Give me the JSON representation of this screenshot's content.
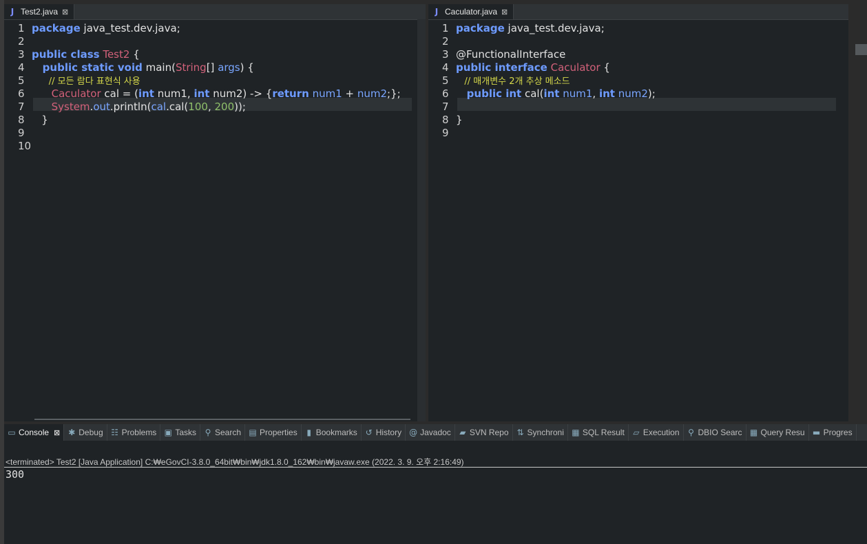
{
  "left_editor": {
    "tab": {
      "icon": "java-file-icon",
      "icon_glyph": "J",
      "label": "Test2.java",
      "close": "⊠"
    },
    "lines": [
      {
        "n": "1",
        "tokens": [
          {
            "t": "package",
            "c": "kw"
          },
          {
            "t": " java_test.dev.java;",
            "c": "plain"
          }
        ]
      },
      {
        "n": "2",
        "tokens": []
      },
      {
        "n": "3",
        "tokens": [
          {
            "t": "public class",
            "c": "kw"
          },
          {
            "t": " ",
            "c": "plain"
          },
          {
            "t": "Test2",
            "c": "cls"
          },
          {
            "t": " {",
            "c": "plain"
          }
        ]
      },
      {
        "n": "4",
        "tokens": [
          {
            "t": "   public static void",
            "c": "kw"
          },
          {
            "t": " main(",
            "c": "plain"
          },
          {
            "t": "String",
            "c": "cls"
          },
          {
            "t": "[] ",
            "c": "plain"
          },
          {
            "t": "args",
            "c": "par"
          },
          {
            "t": ") {",
            "c": "plain"
          }
        ]
      },
      {
        "n": "5",
        "tokens": [
          {
            "t": "      // 모든 람다 표현식 사용",
            "c": "cm"
          }
        ]
      },
      {
        "n": "6",
        "tokens": [
          {
            "t": "      Caculator",
            "c": "cls"
          },
          {
            "t": " cal = (",
            "c": "plain"
          },
          {
            "t": "int",
            "c": "kw"
          },
          {
            "t": " num1, ",
            "c": "plain"
          },
          {
            "t": "int",
            "c": "kw"
          },
          {
            "t": " num2) -> {",
            "c": "plain"
          },
          {
            "t": "return",
            "c": "kw"
          },
          {
            "t": " ",
            "c": "plain"
          },
          {
            "t": "num1",
            "c": "par"
          },
          {
            "t": " + ",
            "c": "plain"
          },
          {
            "t": "num2",
            "c": "par"
          },
          {
            "t": ";};",
            "c": "plain"
          }
        ]
      },
      {
        "n": "7",
        "tokens": [
          {
            "t": "      System",
            "c": "cls"
          },
          {
            "t": ".",
            "c": "plain"
          },
          {
            "t": "out",
            "c": "fld"
          },
          {
            "t": ".println(",
            "c": "plain"
          },
          {
            "t": "cal",
            "c": "par"
          },
          {
            "t": ".cal(",
            "c": "plain"
          },
          {
            "t": "100",
            "c": "num"
          },
          {
            "t": ", ",
            "c": "plain"
          },
          {
            "t": "200",
            "c": "num"
          },
          {
            "t": "));",
            "c": "plain"
          }
        ]
      },
      {
        "n": "8",
        "tokens": [
          {
            "t": "   }",
            "c": "plain"
          }
        ]
      },
      {
        "n": "9",
        "tokens": [
          {
            "t": "",
            "c": "plain"
          }
        ]
      },
      {
        "n": "10",
        "tokens": []
      }
    ]
  },
  "right_editor": {
    "tab": {
      "icon": "java-file-icon",
      "icon_glyph": "J",
      "label": "Caculator.java",
      "close": "⊠"
    },
    "lines": [
      {
        "n": "1",
        "tokens": [
          {
            "t": "package",
            "c": "kw"
          },
          {
            "t": " java_test.dev.java;",
            "c": "plain"
          }
        ]
      },
      {
        "n": "2",
        "tokens": []
      },
      {
        "n": "3",
        "tokens": [
          {
            "t": "@FunctionalInterface",
            "c": "plain"
          }
        ]
      },
      {
        "n": "4",
        "tokens": [
          {
            "t": "public interface",
            "c": "kw"
          },
          {
            "t": " ",
            "c": "plain"
          },
          {
            "t": "Caculator",
            "c": "cls"
          },
          {
            "t": " {",
            "c": "plain"
          }
        ]
      },
      {
        "n": "5",
        "tokens": [
          {
            "t": "   // 매개변수 2개 추상 메소드",
            "c": "cm"
          }
        ]
      },
      {
        "n": "6",
        "tokens": [
          {
            "t": "   public int",
            "c": "kw"
          },
          {
            "t": " cal(",
            "c": "plain"
          },
          {
            "t": "int",
            "c": "kw"
          },
          {
            "t": " ",
            "c": "plain"
          },
          {
            "t": "num1",
            "c": "par"
          },
          {
            "t": ", ",
            "c": "plain"
          },
          {
            "t": "int",
            "c": "kw"
          },
          {
            "t": " ",
            "c": "plain"
          },
          {
            "t": "num2",
            "c": "par"
          },
          {
            "t": ");",
            "c": "plain"
          }
        ]
      },
      {
        "n": "7",
        "tokens": []
      },
      {
        "n": "8",
        "tokens": [
          {
            "t": "}",
            "c": "plain"
          }
        ]
      },
      {
        "n": "9",
        "tokens": []
      }
    ]
  },
  "console": {
    "tabs": [
      {
        "icon": "console-icon",
        "glyph": "▭",
        "label": "Console",
        "close": "⊠",
        "active": true
      },
      {
        "icon": "debug-icon",
        "glyph": "✱",
        "label": "Debug"
      },
      {
        "icon": "problems-icon",
        "glyph": "☷",
        "label": "Problems"
      },
      {
        "icon": "tasks-icon",
        "glyph": "▣",
        "label": "Tasks"
      },
      {
        "icon": "search-icon",
        "glyph": "⚲",
        "label": "Search"
      },
      {
        "icon": "properties-icon",
        "glyph": "▤",
        "label": "Properties"
      },
      {
        "icon": "bookmark-icon",
        "glyph": "▮",
        "label": "Bookmarks"
      },
      {
        "icon": "history-icon",
        "glyph": "↺",
        "label": "History"
      },
      {
        "icon": "javadoc-icon",
        "glyph": "@",
        "label": "Javadoc"
      },
      {
        "icon": "svn-icon",
        "glyph": "▰",
        "label": "SVN Repo"
      },
      {
        "icon": "synchronize-icon",
        "glyph": "⇅",
        "label": "Synchroni"
      },
      {
        "icon": "sql-result-icon",
        "glyph": "▦",
        "label": "SQL Result"
      },
      {
        "icon": "execution-icon",
        "glyph": "▱",
        "label": "Execution"
      },
      {
        "icon": "dbio-search-icon",
        "glyph": "⚲",
        "label": "DBIO Searc"
      },
      {
        "icon": "query-result-icon",
        "glyph": "▦",
        "label": "Query Resu"
      },
      {
        "icon": "progress-icon",
        "glyph": "▬",
        "label": "Progres"
      }
    ],
    "status": "<terminated> Test2 [Java Application] C:₩eGovCI-3.8.0_64bit₩bin₩jdk1.8.0_162₩bin₩javaw.exe (2022. 3. 9. 오후 2:16:49)",
    "output": "300"
  },
  "colors": {
    "keyword": "#6e9bff",
    "class": "#d2617a",
    "comment": "#d5d84a",
    "number": "#8fc06a",
    "background": "#1f2326"
  }
}
